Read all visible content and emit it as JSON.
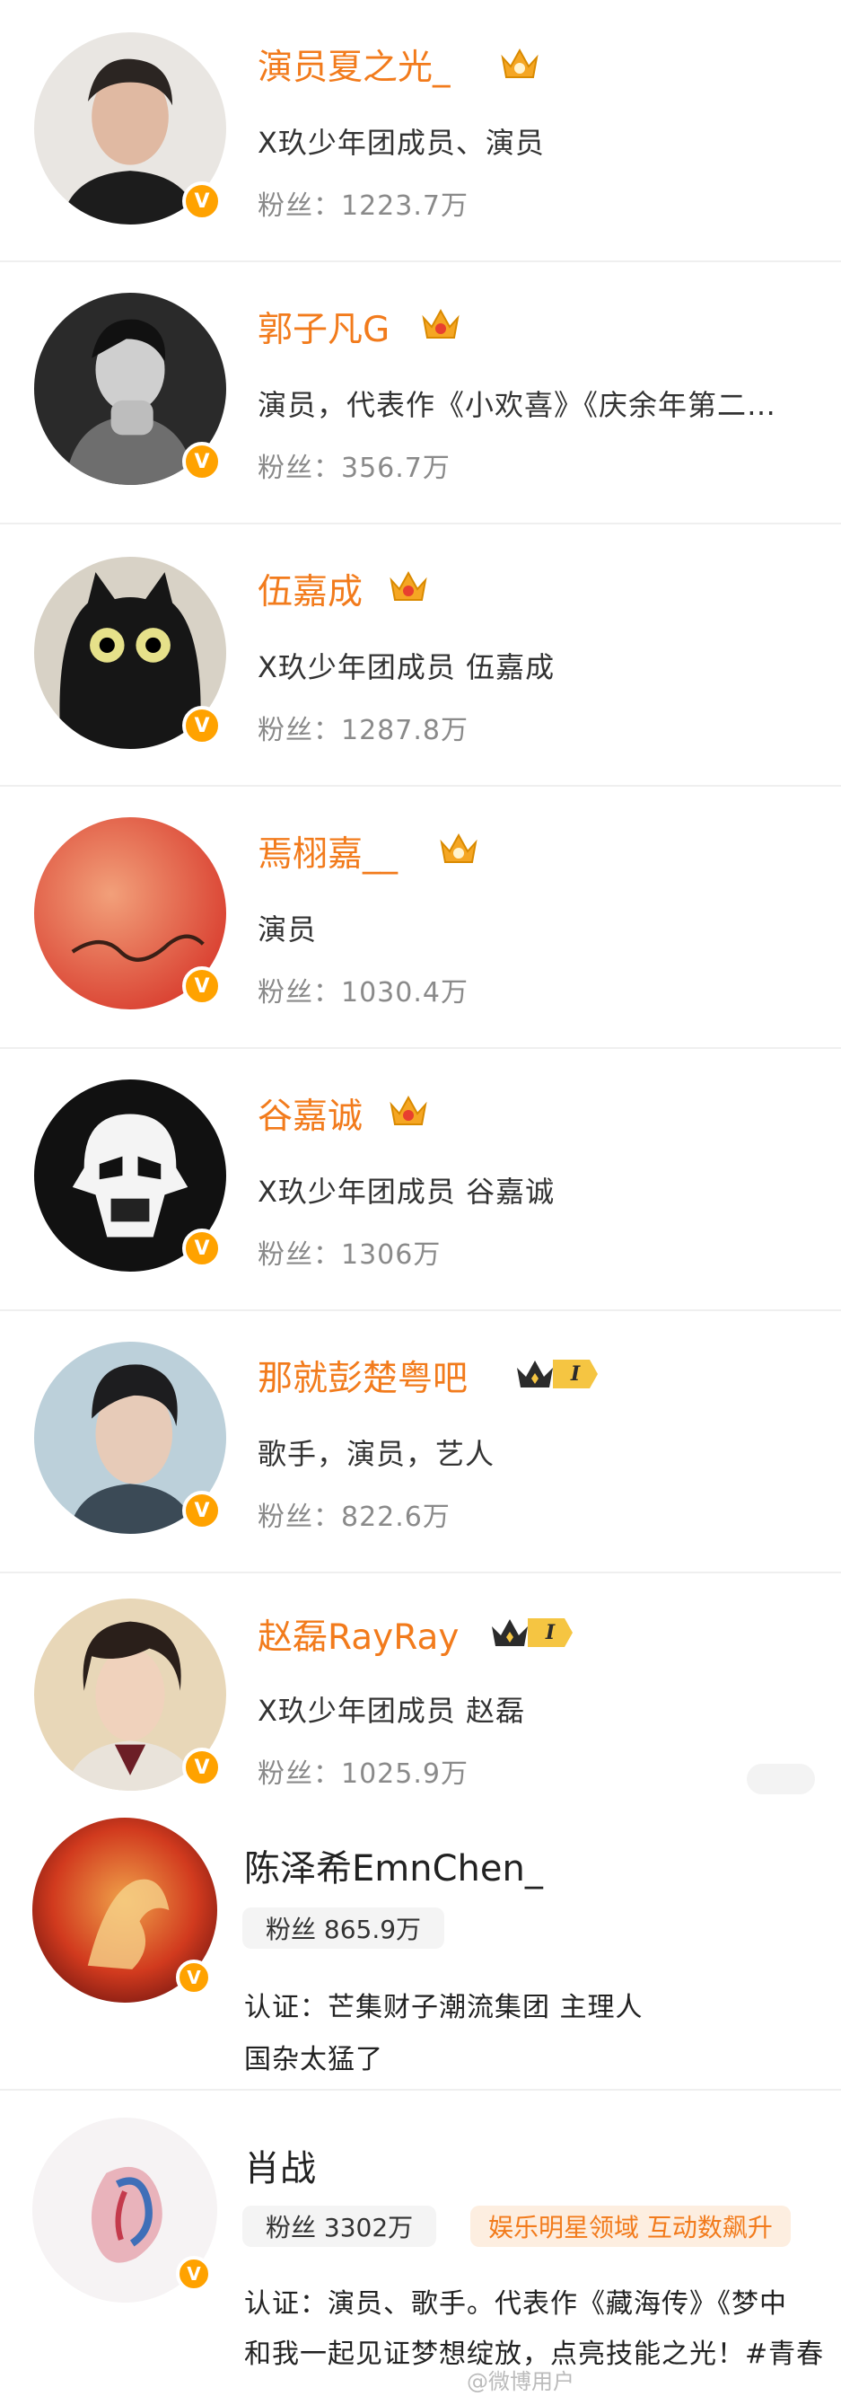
{
  "users": [
    {
      "name": "演员夏之光_",
      "desc": "X玖少年团成员、演员",
      "fans": "粉丝：1223.7万",
      "badge": "V"
    },
    {
      "name": "郭子凡G",
      "desc": "演员，代表作《小欢喜》《庆余年第二…",
      "fans": "粉丝：356.7万",
      "badge": "V"
    },
    {
      "name": "伍嘉成",
      "desc": "X玖少年团成员  伍嘉成",
      "fans": "粉丝：1287.8万",
      "badge": "V"
    },
    {
      "name": "焉栩嘉__",
      "desc": "演员",
      "fans": "粉丝：1030.4万",
      "badge": "V"
    },
    {
      "name": "谷嘉诚",
      "desc": "X玖少年团成员  谷嘉诚",
      "fans": "粉丝：1306万",
      "badge": "V"
    },
    {
      "name": "那就彭楚粤吧",
      "desc": "歌手，演员，艺人",
      "fans": "粉丝：822.6万",
      "badge": "V",
      "rank": "I"
    },
    {
      "name": "赵磊RayRay",
      "desc": "X玖少年团成员 赵磊",
      "fans": "粉丝：1025.9万",
      "badge": "V",
      "rank": "I"
    }
  ],
  "user8": {
    "name": "陈泽希EmnChen_",
    "fans": "粉丝 865.9万",
    "verify": "认证：芒集财子潮流集团 主理人",
    "bio": "国杂太猛了",
    "badge": "V"
  },
  "user9": {
    "name": "肖战",
    "fans": "粉丝 3302万",
    "tag": "娱乐明星领域 互动数飙升",
    "verify": "认证：演员、歌手。代表作《藏海传》《梦中",
    "bio": "和我一起见证梦想绽放，点亮技能之光！#青春",
    "badge": "V"
  },
  "watermark": "@微博用户",
  "colors": {
    "accent": "#f27b1c",
    "badge": "#ffa200",
    "divider": "#efefef"
  }
}
